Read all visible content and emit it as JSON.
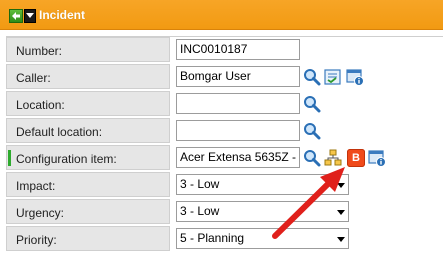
{
  "header": {
    "title": "Incident",
    "back_icon": "back-arrow-icon",
    "menu_icon": "dropdown-menu-icon"
  },
  "fields": {
    "number": {
      "label": "Number:",
      "value": "INC0010187"
    },
    "caller": {
      "label": "Caller:",
      "value": "Bomgar User"
    },
    "location": {
      "label": "Location:",
      "value": ""
    },
    "default_location": {
      "label": "Default location:",
      "value": ""
    },
    "configuration_item": {
      "label": "Configuration item:",
      "value": "Acer Extensa 5635Z - ",
      "badge": "B"
    },
    "impact": {
      "label": "Impact:",
      "value": "3 - Low"
    },
    "urgency": {
      "label": "Urgency:",
      "value": "3 - Low"
    },
    "priority": {
      "label": "Priority:",
      "value": "5 - Planning"
    }
  },
  "colors": {
    "header": "#f29a12",
    "mandatory": "#2eaa2e",
    "badge": "#f04a1a",
    "arrow": "#e0201b"
  }
}
